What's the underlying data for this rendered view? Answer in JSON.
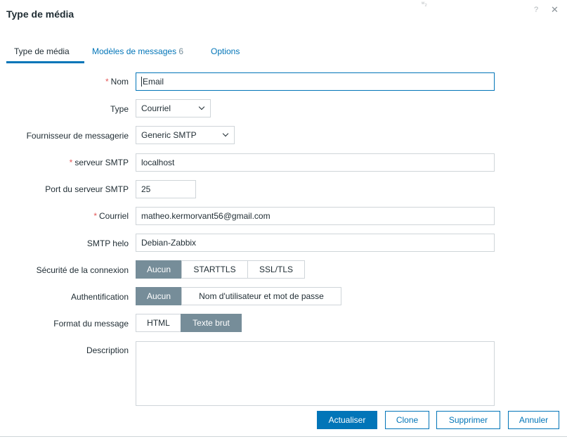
{
  "dialog": {
    "title": "Type de média",
    "help_glyph": "?",
    "close_glyph": "✕",
    "stray_glyph": "ʷ₂"
  },
  "tabs": [
    {
      "label": "Type de média",
      "count": ""
    },
    {
      "label": "Modèles de messages",
      "count": "6"
    },
    {
      "label": "Options",
      "count": ""
    }
  ],
  "form": {
    "required_marker": "*",
    "name": {
      "label": "Nom",
      "value": "Email"
    },
    "type": {
      "label": "Type",
      "value": "Courriel"
    },
    "provider": {
      "label": "Fournisseur de messagerie",
      "value": "Generic SMTP"
    },
    "smtp_server": {
      "label": "serveur SMTP",
      "value": "localhost"
    },
    "smtp_port": {
      "label": "Port du serveur SMTP",
      "value": "25"
    },
    "email": {
      "label": "Courriel",
      "value": "matheo.kermorvant56@gmail.com"
    },
    "smtp_helo": {
      "label": "SMTP helo",
      "value": "Debian-Zabbix"
    },
    "security": {
      "label": "Sécurité de la connexion",
      "options": [
        "Aucun",
        "STARTTLS",
        "SSL/TLS"
      ],
      "selected": "Aucun"
    },
    "auth": {
      "label": "Authentification",
      "options": [
        "Aucun",
        "Nom d'utilisateur et mot de passe"
      ],
      "selected": "Aucun"
    },
    "format": {
      "label": "Format du message",
      "options": [
        "HTML",
        "Texte brut"
      ],
      "selected": "Texte brut"
    },
    "description": {
      "label": "Description",
      "value": ""
    }
  },
  "footer": {
    "update": "Actualiser",
    "clone": "Clone",
    "delete": "Supprimer",
    "cancel": "Annuler"
  },
  "colors": {
    "accent": "#0275b8",
    "segment_selected": "#768d99",
    "required": "#e45959"
  }
}
